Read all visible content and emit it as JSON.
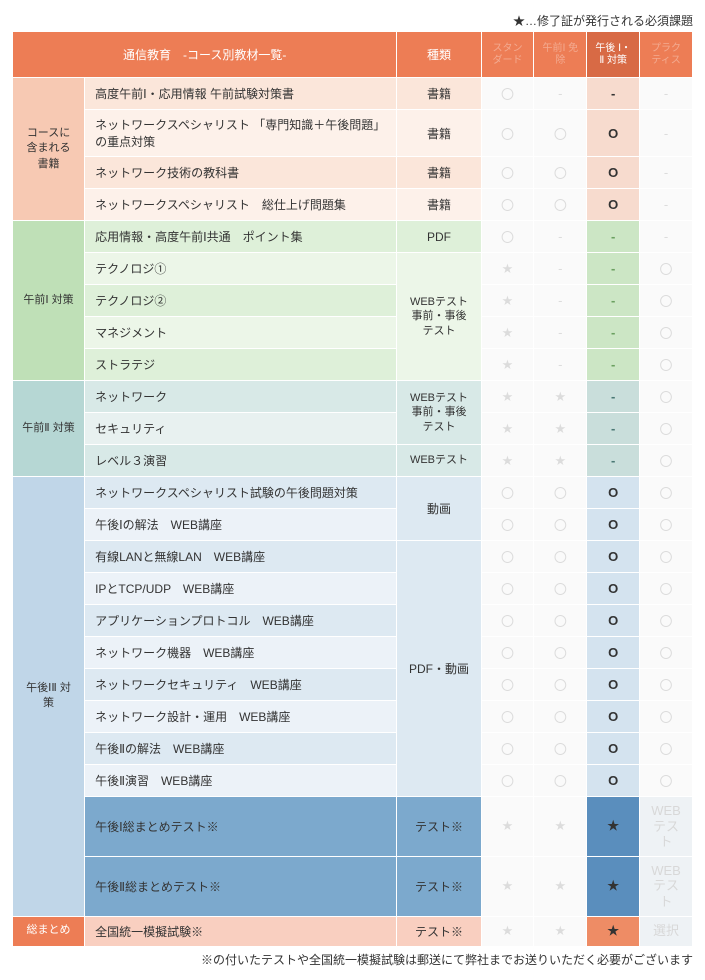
{
  "top_note": "★…修了証が発行される必須課題",
  "header": {
    "title": "通信教育　-コース別教材一覧-",
    "type": "種類",
    "plans": [
      "スタン\nダード",
      "午前Ⅰ\n免除",
      "午後\nⅠ・Ⅱ\n対策",
      "プラク\nティス"
    ]
  },
  "marks": {
    "circle": "〇",
    "bigO": "O",
    "star": "★",
    "dash": "-"
  },
  "webtest_label": "WEB\nテスト",
  "select_label": "選択",
  "sections": {
    "books": {
      "label": "コースに\n含まれる\n書籍",
      "type": "書籍",
      "rows": [
        {
          "name": "高度午前Ⅰ・応用情報 午前試験対策書",
          "status": [
            "circle",
            "dash",
            "dash",
            "dash"
          ]
        },
        {
          "name": "ネットワークスペシャリスト\n「専門知識＋午後問題」の重点対策",
          "status": [
            "circle",
            "circle",
            "bigO",
            "dash"
          ]
        },
        {
          "name": "ネットワーク技術の教科書",
          "status": [
            "circle",
            "circle",
            "bigO",
            "dash"
          ]
        },
        {
          "name": "ネットワークスペシャリスト　総仕上げ問題集",
          "status": [
            "circle",
            "circle",
            "bigO",
            "dash"
          ]
        }
      ]
    },
    "am1": {
      "label": "午前Ⅰ\n対策",
      "type_pdf": "PDF",
      "type_web": "WEBテスト\n\n事前・事後\nテスト",
      "rows": [
        {
          "name": "応用情報・高度午前Ⅰ共通　ポイント集",
          "status": [
            "circle",
            "dash",
            "dash",
            "dash"
          ]
        },
        {
          "name": "テクノロジ①",
          "status": [
            "star",
            "dash",
            "dash",
            "circle"
          ]
        },
        {
          "name": "テクノロジ②",
          "status": [
            "star",
            "dash",
            "dash",
            "circle"
          ]
        },
        {
          "name": "マネジメント",
          "status": [
            "star",
            "dash",
            "dash",
            "circle"
          ]
        },
        {
          "name": "ストラテジ",
          "status": [
            "star",
            "dash",
            "dash",
            "circle"
          ]
        }
      ]
    },
    "am2": {
      "label": "午前Ⅱ\n対策",
      "type_web": "WEBテスト\n事前・事後\nテスト",
      "type_web2": "WEBテスト",
      "rows": [
        {
          "name": "ネットワーク",
          "status": [
            "star",
            "star",
            "dash",
            "circle"
          ]
        },
        {
          "name": "セキュリティ",
          "status": [
            "star",
            "star",
            "dash",
            "circle"
          ]
        },
        {
          "name": "レベル３演習",
          "status": [
            "star",
            "star",
            "dash",
            "circle"
          ]
        }
      ]
    },
    "pm": {
      "label": "午後ⅠⅡ\n対策",
      "type_movie": "動画",
      "type_pdfmovie": "PDF・動画",
      "type_test": "テスト※",
      "rows": [
        {
          "name": "ネットワークスペシャリスト試験の午後問題対策",
          "status": [
            "circle",
            "circle",
            "bigO",
            "circle"
          ]
        },
        {
          "name": "午後Ⅰの解法　WEB講座",
          "status": [
            "circle",
            "circle",
            "bigO",
            "circle"
          ]
        },
        {
          "name": "有線LANと無線LAN　WEB講座",
          "status": [
            "circle",
            "circle",
            "bigO",
            "circle"
          ]
        },
        {
          "name": "IPとTCP/UDP　WEB講座",
          "status": [
            "circle",
            "circle",
            "bigO",
            "circle"
          ]
        },
        {
          "name": "アプリケーションプロトコル　WEB講座",
          "status": [
            "circle",
            "circle",
            "bigO",
            "circle"
          ]
        },
        {
          "name": "ネットワーク機器　WEB講座",
          "status": [
            "circle",
            "circle",
            "bigO",
            "circle"
          ]
        },
        {
          "name": "ネットワークセキュリティ　WEB講座",
          "status": [
            "circle",
            "circle",
            "bigO",
            "circle"
          ]
        },
        {
          "name": "ネットワーク設計・運用　WEB講座",
          "status": [
            "circle",
            "circle",
            "bigO",
            "circle"
          ]
        },
        {
          "name": "午後Ⅱの解法　WEB講座",
          "status": [
            "circle",
            "circle",
            "bigO",
            "circle"
          ]
        },
        {
          "name": "午後Ⅱ演習　WEB講座",
          "status": [
            "circle",
            "circle",
            "bigO",
            "circle"
          ]
        },
        {
          "name": "午後Ⅰ総まとめテスト※",
          "dark": true,
          "status": [
            "star",
            "star",
            "star",
            "web"
          ]
        },
        {
          "name": "午後Ⅱ総まとめテスト※",
          "dark": true,
          "status": [
            "star",
            "star",
            "star",
            "web"
          ]
        }
      ]
    },
    "summary": {
      "label": "総まとめ",
      "type_test": "テスト※",
      "rows": [
        {
          "name": "全国統一模擬試験※",
          "status": [
            "star",
            "star",
            "star",
            "select"
          ]
        }
      ]
    }
  },
  "bottom_note": "※の付いたテストや全国統一模擬試験は郵送にて弊社までお送りいただく必要がございます"
}
